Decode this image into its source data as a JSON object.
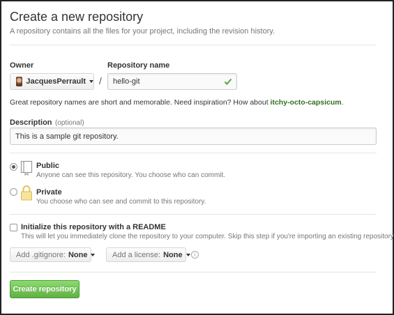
{
  "header": {
    "title": "Create a new repository",
    "subtitle": "A repository contains all the files for your project, including the revision history."
  },
  "owner": {
    "label": "Owner",
    "value": "JacquesPerrault"
  },
  "separator": "/",
  "repo_name": {
    "label": "Repository name",
    "value": "hello-git",
    "valid": true
  },
  "hint": {
    "text": "Great repository names are short and memorable. Need inspiration? How about ",
    "suggestion": "itchy-octo-capsicum",
    "end": "."
  },
  "description": {
    "label": "Description",
    "optional": "(optional)",
    "value": "This is a sample git repository."
  },
  "visibility": {
    "selected": "public",
    "public": {
      "title": "Public",
      "desc": "Anyone can see this repository. You choose who can commit."
    },
    "private": {
      "title": "Private",
      "desc": "You choose who can see and commit to this repository."
    }
  },
  "init": {
    "checked": false,
    "title": "Initialize this repository with a README",
    "desc": "This will let you immediately clone the repository to your computer. Skip this step if you're importing an existing repository."
  },
  "gitignore": {
    "label": "Add .gitignore:",
    "value": "None"
  },
  "license": {
    "label": "Add a license:",
    "value": "None"
  },
  "info_icon": "i",
  "submit": {
    "label": "Create repository"
  },
  "colors": {
    "accent_green": "#60b044",
    "suggestion_green": "#2f6f1f",
    "check_green": "#55a532"
  }
}
